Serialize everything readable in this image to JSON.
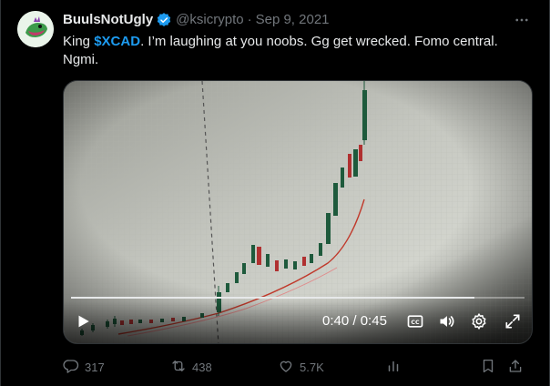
{
  "author": {
    "name": "BuulsNotUgly",
    "handle": "@ksicrypto",
    "date": "Sep 9, 2021",
    "separator": "·"
  },
  "tweet": {
    "prefix": "King ",
    "cashtag": "$XCAD",
    "body": ". I’m laughing at you noobs. Gg get wrecked. Fomo central. Ngmi."
  },
  "video": {
    "current_time": "0:40",
    "duration": "0:45",
    "time_separator": " / ",
    "progress": 0.89
  },
  "stats": {
    "replies": "317",
    "retweets": "438",
    "likes": "5.7K"
  },
  "colors": {
    "accent": "#1d9bf0",
    "text": "#e7e9ea",
    "muted": "#71767b",
    "verified": "#1d9bf0"
  },
  "icons": {
    "verified": "verified-badge-icon",
    "more": "more-dots-icon",
    "play": "play-icon",
    "captions": "captions-icon",
    "volume": "volume-icon",
    "settings": "gear-icon",
    "fullscreen": "fullscreen-icon",
    "reply": "reply-icon",
    "retweet": "retweet-icon",
    "like": "heart-icon",
    "views": "analytics-icon",
    "bookmark": "bookmark-icon",
    "share": "share-icon"
  }
}
